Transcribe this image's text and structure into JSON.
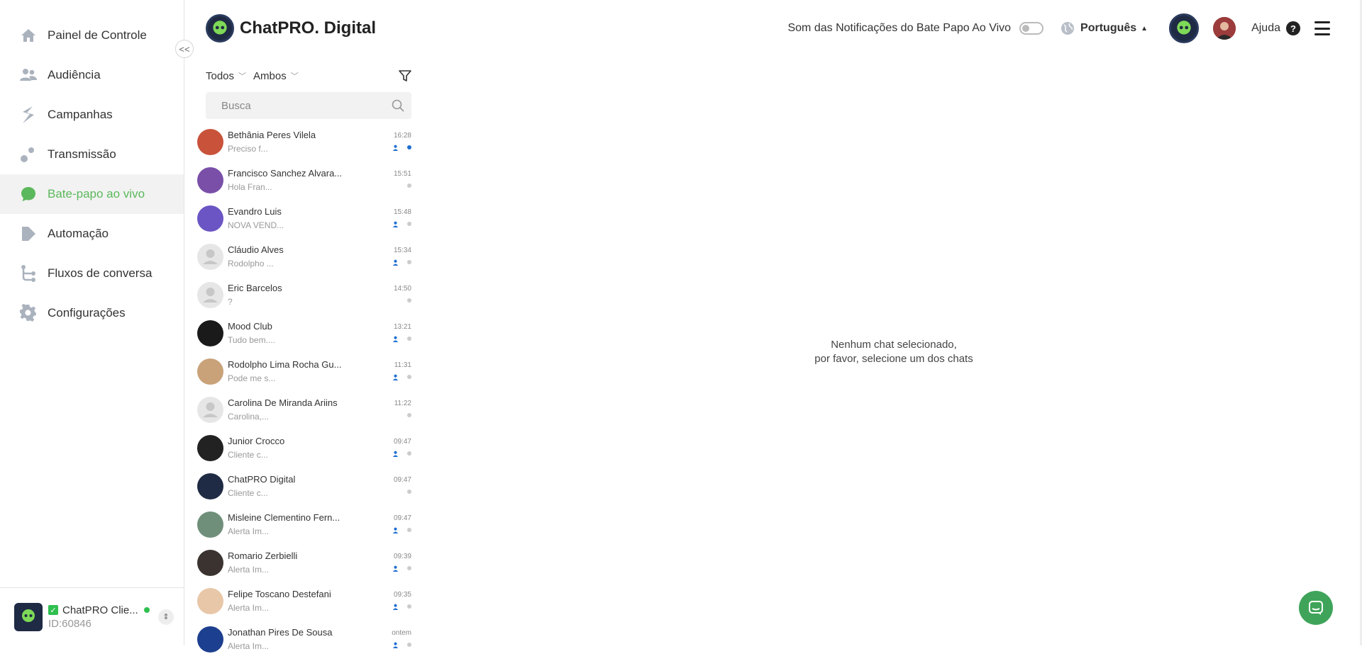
{
  "sidebar": {
    "items": [
      {
        "label": "Painel de Controle",
        "icon": "home-icon",
        "active": false
      },
      {
        "label": "Audiência",
        "icon": "users-icon",
        "active": false
      },
      {
        "label": "Campanhas",
        "icon": "campaigns-icon",
        "active": false
      },
      {
        "label": "Transmissão",
        "icon": "broadcast-icon",
        "active": false
      },
      {
        "label": "Bate-papo ao vivo",
        "icon": "chat-bubble-icon",
        "active": true
      },
      {
        "label": "Automação",
        "icon": "automation-icon",
        "active": false
      },
      {
        "label": "Fluxos de conversa",
        "icon": "flow-icon",
        "active": false
      },
      {
        "label": "Configurações",
        "icon": "gear-icon",
        "active": false
      }
    ],
    "collapse_label": "<<",
    "account": {
      "name": "ChatPRO Clie...",
      "id": "ID:60846"
    }
  },
  "header": {
    "brand": "ChatPRO. Digital",
    "notif_label": "Som das Notificações do Bate Papo Ao Vivo",
    "language": "Português",
    "help": "Ajuda",
    "help_symbol": "?"
  },
  "filters": {
    "status": "Todos",
    "channel": "Ambos"
  },
  "search": {
    "placeholder": "Busca"
  },
  "chats": [
    {
      "name": "Bethânia Peres Vilela",
      "preview": "Preciso f...",
      "time": "16:28",
      "agent": true,
      "unread": true,
      "avatar_color": "#c9523a"
    },
    {
      "name": "Francisco Sanchez Alvara...",
      "preview": "Hola Fran...",
      "time": "15:51",
      "agent": false,
      "unread": false,
      "avatar_color": "#7a4fa8"
    },
    {
      "name": "Evandro Luis",
      "preview": "NOVA VEND...",
      "time": "15:48",
      "agent": true,
      "unread": false,
      "avatar_color": "#6b55c4"
    },
    {
      "name": "Cláudio Alves",
      "preview": "Rodolpho ...",
      "time": "15:34",
      "agent": true,
      "unread": false,
      "avatar_color": "#e6e6e6"
    },
    {
      "name": "Eric Barcelos",
      "preview": "?",
      "time": "14:50",
      "agent": false,
      "unread": false,
      "avatar_color": "#e6e6e6"
    },
    {
      "name": "Mood Club",
      "preview": "Tudo bem....",
      "time": "13:21",
      "agent": true,
      "unread": false,
      "avatar_color": "#1a1a1a"
    },
    {
      "name": "Rodolpho Lima Rocha Gu...",
      "preview": "Pode me s...",
      "time": "11:31",
      "agent": true,
      "unread": false,
      "avatar_color": "#c9a27a"
    },
    {
      "name": "Carolina De Miranda Ariins",
      "preview": "Carolina,...",
      "time": "11:22",
      "agent": false,
      "unread": false,
      "avatar_color": "#e6e6e6"
    },
    {
      "name": "Junior Crocco",
      "preview": "Cliente c...",
      "time": "09:47",
      "agent": true,
      "unread": false,
      "avatar_color": "#222222"
    },
    {
      "name": "ChatPRO Digital",
      "preview": "Cliente c...",
      "time": "09:47",
      "agent": false,
      "unread": false,
      "avatar_color": "#1f2a44"
    },
    {
      "name": "Misleine Clementino Fern...",
      "preview": "Alerta Im...",
      "time": "09:47",
      "agent": true,
      "unread": false,
      "avatar_color": "#6f8f7a"
    },
    {
      "name": "Romario Zerbielli",
      "preview": "Alerta Im...",
      "time": "09:39",
      "agent": true,
      "unread": false,
      "avatar_color": "#3a3330"
    },
    {
      "name": "Felipe Toscano Destefani",
      "preview": "Alerta Im...",
      "time": "09:35",
      "agent": true,
      "unread": false,
      "avatar_color": "#e8c7a8"
    },
    {
      "name": "Jonathan Pires De Sousa",
      "preview": "Alerta Im...",
      "time": "ontem",
      "agent": true,
      "unread": false,
      "avatar_color": "#1d3f8f"
    }
  ],
  "empty_state": {
    "line1": "Nenhum chat selecionado,",
    "line2": "por favor, selecione um dos chats"
  },
  "colors": {
    "accent": "#5cb85c",
    "unread": "#1f6fd1",
    "fab": "#3fa45a"
  }
}
